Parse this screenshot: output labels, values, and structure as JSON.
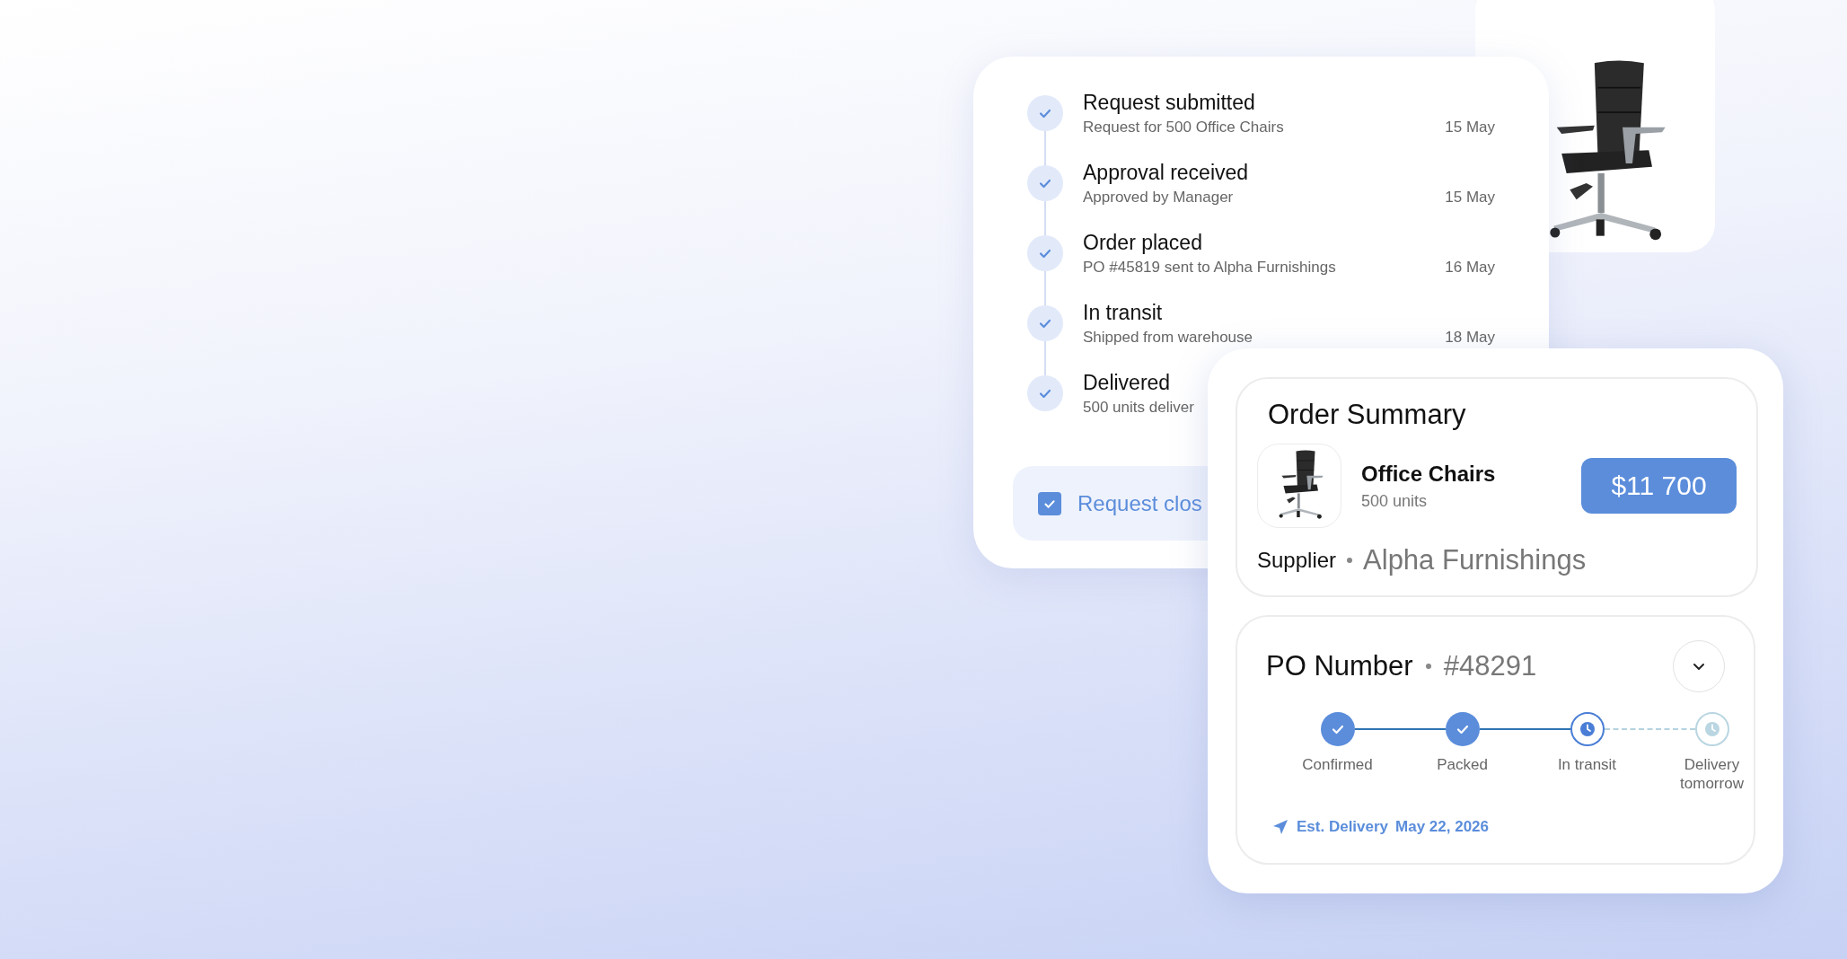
{
  "timeline": {
    "events": [
      {
        "title": "Request submitted",
        "detail": "Request for 500 Office Chairs",
        "date": "15 May",
        "completed": true
      },
      {
        "title": "Approval received",
        "detail": "Approved by Manager",
        "date": "15 May",
        "completed": true
      },
      {
        "title": "Order placed",
        "detail": "PO #45819 sent to Alpha Furnishings",
        "date": "16 May",
        "completed": true
      },
      {
        "title": "In transit",
        "detail": "Shipped from warehouse",
        "date": "18 May",
        "completed": true
      },
      {
        "title": "Delivered",
        "detail": "500 units deliver",
        "completed": true
      }
    ],
    "closed": {
      "label": "Request clos",
      "checked": true
    }
  },
  "order_summary": {
    "title": "Order Summary",
    "item": {
      "name": "Office Chairs",
      "quantity": "500 units",
      "price": "$11 700"
    },
    "supplier_label": "Supplier",
    "supplier": "Alpha Furnishings"
  },
  "po": {
    "label": "PO Number",
    "number": "#48291",
    "expanded": false,
    "steps": [
      {
        "label": "Confirmed",
        "kind": "done"
      },
      {
        "label": "Packed",
        "kind": "done"
      },
      {
        "label": "In transit",
        "kind": "current"
      },
      {
        "label": "Delivery tomorrow",
        "kind": "upcoming"
      }
    ],
    "eta_label": "Est. Delivery",
    "eta": "May 22, 2026"
  }
}
